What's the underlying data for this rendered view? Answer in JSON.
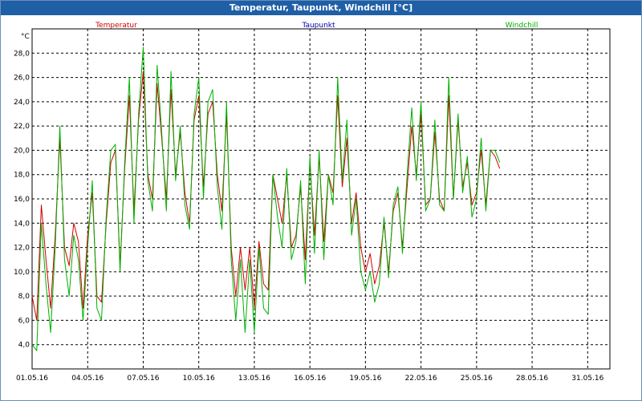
{
  "window": {
    "title": "Temperatur, Taupunkt, Windchill [°C]"
  },
  "chart_data": {
    "type": "line",
    "unit_label": "°C",
    "x_tick_labels": [
      "01.05.16",
      "04.05.16",
      "07.05.16",
      "10.05.16",
      "13.05.16",
      "16.05.16",
      "19.05.16",
      "22.05.16",
      "25.05.16",
      "28.05.16",
      "31.05.16"
    ],
    "y_ticks": [
      4.0,
      6.0,
      8.0,
      10.0,
      12.0,
      14.0,
      16.0,
      18.0,
      20.0,
      22.0,
      24.0,
      26.0,
      28.0
    ],
    "y_tick_labels": [
      "4,0",
      "6,0",
      "8,0",
      "10,0",
      "12,0",
      "14,0",
      "16,0",
      "18,0",
      "20,0",
      "22,0",
      "24,0",
      "26,0",
      "28,0"
    ],
    "ylim": [
      2.0,
      30.0
    ],
    "xlim_days": [
      0,
      31.2
    ],
    "grid": true,
    "legend_position": "top",
    "x": [
      0,
      0.25,
      0.5,
      0.75,
      1,
      1.25,
      1.5,
      1.75,
      2,
      2.25,
      2.5,
      2.75,
      3,
      3.25,
      3.5,
      3.75,
      4,
      4.25,
      4.5,
      4.75,
      5,
      5.25,
      5.5,
      5.75,
      6,
      6.25,
      6.5,
      6.75,
      7,
      7.25,
      7.5,
      7.75,
      8,
      8.25,
      8.5,
      8.75,
      9,
      9.25,
      9.5,
      9.75,
      10,
      10.25,
      10.5,
      10.75,
      11,
      11.25,
      11.5,
      11.75,
      12,
      12.25,
      12.5,
      12.75,
      13,
      13.25,
      13.5,
      13.75,
      14,
      14.25,
      14.5,
      14.75,
      15,
      15.25,
      15.5,
      15.75,
      16,
      16.25,
      16.5,
      16.75,
      17,
      17.25,
      17.5,
      17.75,
      18,
      18.25,
      18.5,
      18.75,
      19,
      19.25,
      19.5,
      19.75,
      20,
      20.25,
      20.5,
      20.75,
      21,
      21.25,
      21.5,
      21.75,
      22,
      22.25,
      22.5,
      22.75,
      23,
      23.25,
      23.5,
      23.75,
      24,
      24.25,
      24.5,
      24.75,
      25,
      25.25,
      25.5,
      25.75,
      26,
      26.25,
      26.5,
      26.75,
      27,
      27.25,
      27.5,
      27.75,
      28,
      28.25,
      28.5,
      28.75,
      29,
      29.25,
      29.5,
      29.75,
      30,
      30.25,
      30.5,
      30.75,
      31,
      31.2
    ],
    "series": [
      {
        "name": "Temperatur",
        "color": "#d00000",
        "values": [
          8.0,
          6.0,
          15.5,
          11.0,
          7.0,
          13.0,
          21.0,
          12.0,
          10.5,
          14.0,
          12.5,
          7.0,
          13.0,
          16.5,
          8.0,
          7.5,
          14.0,
          19.0,
          20.0,
          10.5,
          18.5,
          24.5,
          15.0,
          22.5,
          26.5,
          18.0,
          16.0,
          25.5,
          21.0,
          16.0,
          25.0,
          18.0,
          21.5,
          16.5,
          14.0,
          22.5,
          24.5,
          17.0,
          23.0,
          24.0,
          18.0,
          15.0,
          23.0,
          12.0,
          8.0,
          12.0,
          8.5,
          12.0,
          7.0,
          12.5,
          9.0,
          8.5,
          18.0,
          16.0,
          14.0,
          18.0,
          12.0,
          13.0,
          17.0,
          11.0,
          19.0,
          13.0,
          19.5,
          12.5,
          18.0,
          16.5,
          24.5,
          17.0,
          21.0,
          14.0,
          16.5,
          12.0,
          10.0,
          11.5,
          9.0,
          10.5,
          14.0,
          10.0,
          15.0,
          16.5,
          12.0,
          17.0,
          22.0,
          18.0,
          23.0,
          15.5,
          16.0,
          21.5,
          16.0,
          15.0,
          24.5,
          16.0,
          22.5,
          17.0,
          19.0,
          15.5,
          16.5,
          20.0,
          15.5,
          20.0,
          19.5,
          18.5
        ]
      },
      {
        "name": "Taupunkt",
        "color": "#0000b0",
        "values": []
      },
      {
        "name": "Windchill",
        "color": "#00b000",
        "values": [
          4.0,
          3.5,
          14.0,
          9.0,
          5.0,
          12.0,
          22.0,
          11.0,
          8.0,
          13.0,
          11.0,
          6.0,
          12.0,
          17.5,
          7.0,
          6.0,
          14.5,
          20.0,
          20.5,
          10.0,
          19.0,
          26.0,
          14.0,
          23.0,
          28.5,
          17.5,
          15.0,
          27.0,
          21.5,
          15.0,
          26.5,
          17.5,
          22.0,
          15.5,
          13.5,
          23.0,
          26.0,
          16.0,
          24.0,
          25.0,
          17.0,
          13.5,
          24.0,
          11.0,
          6.0,
          11.0,
          5.0,
          11.0,
          5.0,
          12.0,
          7.0,
          6.5,
          18.0,
          14.5,
          12.0,
          18.5,
          11.0,
          12.5,
          17.5,
          9.0,
          19.5,
          11.5,
          20.0,
          11.0,
          18.0,
          15.5,
          26.0,
          17.5,
          22.5,
          13.0,
          16.0,
          10.0,
          8.5,
          10.0,
          7.5,
          9.0,
          14.5,
          9.5,
          15.5,
          17.0,
          11.5,
          18.0,
          23.5,
          17.5,
          24.0,
          15.0,
          16.0,
          22.5,
          15.5,
          15.0,
          26.0,
          16.0,
          23.0,
          16.5,
          19.5,
          14.5,
          16.0,
          21.0,
          15.0,
          20.0,
          20.0,
          19.0
        ]
      }
    ]
  }
}
